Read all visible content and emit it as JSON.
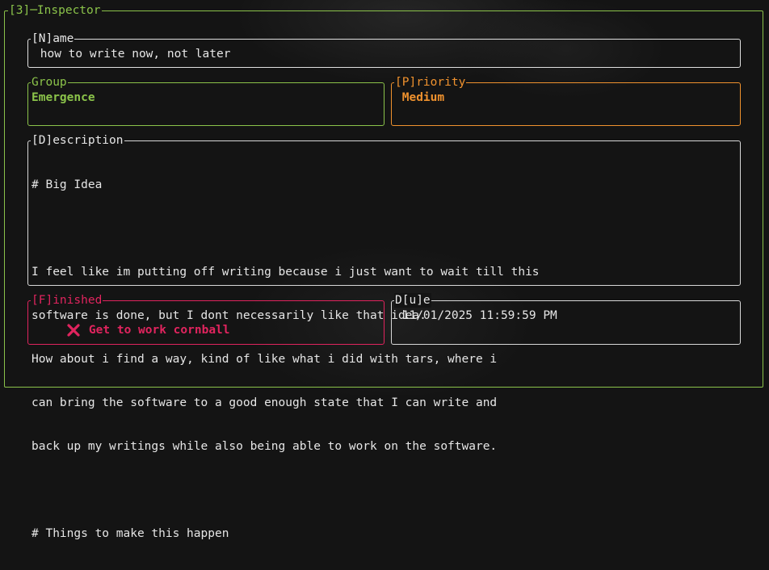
{
  "inspector": {
    "title": "[3]─Inspector"
  },
  "name": {
    "label": "[N]ame",
    "value": " how to write now, not later"
  },
  "group": {
    "label": "Group",
    "value": "Emergence"
  },
  "priority": {
    "label": "[P]riority",
    "value": " Medium"
  },
  "description": {
    "label": "[D]escription",
    "lines": [
      "# Big Idea",
      "",
      "I feel like im putting off writing because i just want to wait till this",
      "software is done, but I dont necessarily like that idea.",
      "How about i find a way, kind of like what i did with tars, where i",
      "can bring the software to a good enough state that I can write and",
      "back up my writings while also being able to work on the software.",
      "",
      "# Things to make this happen"
    ]
  },
  "finished": {
    "label": "[F]inished",
    "icon": "x-mark-icon",
    "value": "Get to work cornball"
  },
  "due": {
    "label": "D[u]e",
    "value": " 11/01/2025 11:59:59 PM"
  },
  "colors": {
    "green": "#8bc34a",
    "orange": "#f0922e",
    "red": "#e0245e",
    "text": "#e6e6e6",
    "background": "#141414"
  }
}
